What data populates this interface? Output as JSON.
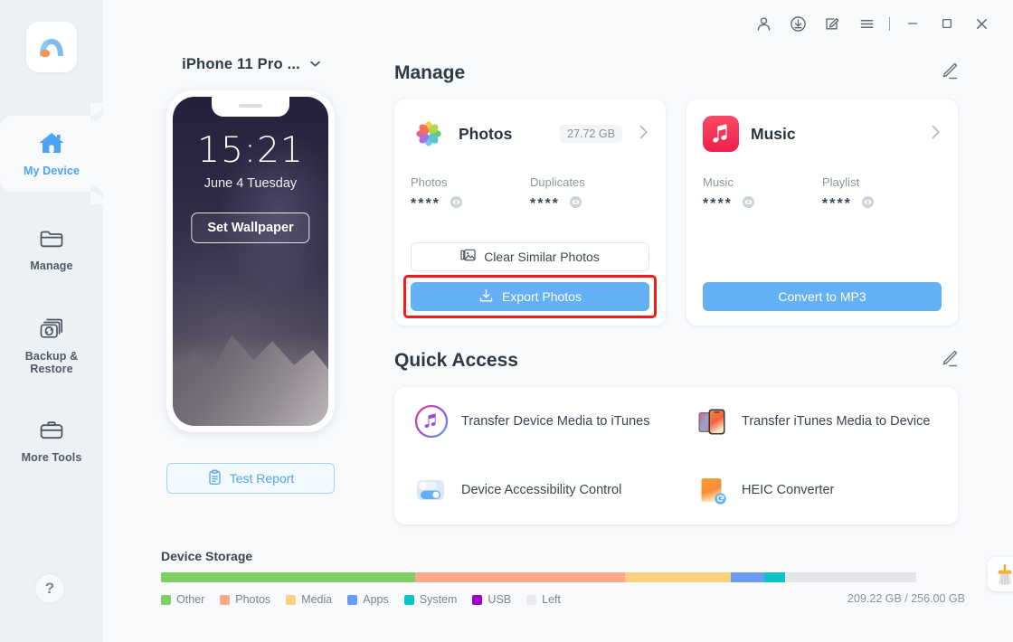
{
  "app": {
    "logo_name": "minitool-mobile-logo"
  },
  "titlebar": {
    "buttons": [
      {
        "name": "account-icon",
        "label": ""
      },
      {
        "name": "download-icon",
        "label": ""
      },
      {
        "name": "feedback-icon",
        "label": ""
      },
      {
        "name": "menu-icon",
        "label": ""
      }
    ],
    "window": [
      {
        "name": "minimize-button",
        "label": ""
      },
      {
        "name": "maximize-button",
        "label": ""
      },
      {
        "name": "close-button",
        "label": ""
      }
    ]
  },
  "sidebar": {
    "items": [
      {
        "label": "My Device",
        "icon": "home-icon",
        "active": true
      },
      {
        "label": "Manage",
        "icon": "folder-icon",
        "active": false
      },
      {
        "label": "Backup &\nRestore",
        "line1": "Backup &",
        "line2": "Restore",
        "icon": "backup-restore-icon",
        "active": false
      },
      {
        "label": "More Tools",
        "icon": "briefcase-icon",
        "active": false
      }
    ],
    "help_label": "?"
  },
  "device": {
    "name": "iPhone 11 Pro ...",
    "dropdown_icon": "chevron-down-icon",
    "lockscreen": {
      "time": "15:21",
      "date": "June 4 Tuesday",
      "wallpaper_button": "Set Wallpaper"
    },
    "tools": [
      {
        "name": "power-icon",
        "color": "#ef3b3b"
      },
      {
        "name": "brightness-icon",
        "color": "#9aa3ad"
      },
      {
        "name": "refresh-icon",
        "color": "#5a636e"
      }
    ],
    "test_report_label": "Test Report"
  },
  "manage": {
    "title": "Manage",
    "edit_icon": "pencil-icon",
    "cards": [
      {
        "name": "photos",
        "icon": "photos-app-icon",
        "title": "Photos",
        "size": "27.72 GB",
        "stats": [
          {
            "label": "Photos",
            "value": "****"
          },
          {
            "label": "Duplicates",
            "value": "****"
          }
        ],
        "secondary_button": {
          "label": "Clear Similar Photos",
          "icon": "similar-photos-icon"
        },
        "primary_button": {
          "label": "Export Photos",
          "icon": "export-icon"
        },
        "highlighted": true
      },
      {
        "name": "music",
        "icon": "music-app-icon",
        "title": "Music",
        "size": "",
        "stats": [
          {
            "label": "Music",
            "value": "****"
          },
          {
            "label": "Playlist",
            "value": "****"
          }
        ],
        "secondary_button": null,
        "primary_button": {
          "label": "Convert to MP3",
          "icon": ""
        },
        "highlighted": false
      }
    ]
  },
  "quick_access": {
    "title": "Quick Access",
    "edit_icon": "pencil-icon",
    "items": [
      {
        "label": "Transfer Device Media to iTunes",
        "icon": "itunes-icon"
      },
      {
        "label": "Transfer iTunes Media to Device",
        "icon": "devices-transfer-icon"
      },
      {
        "label": "Device Accessibility Control",
        "icon": "toggle-icon"
      },
      {
        "label": "HEIC Converter",
        "icon": "heic-converter-icon"
      }
    ]
  },
  "storage": {
    "title": "Device Storage",
    "total_text": "209.22 GB / 256.00 GB",
    "clean_icon": "broom-icon",
    "segments": [
      {
        "label": "Other",
        "color": "#7ed063",
        "percent": 33.6
      },
      {
        "label": "Photos",
        "color": "#ffa98a",
        "percent": 27.8
      },
      {
        "label": "Media",
        "color": "#fbd080",
        "percent": 14.1
      },
      {
        "label": "Apps",
        "color": "#6b9bf5",
        "percent": 4.4
      },
      {
        "label": "System",
        "color": "#0cc2c2",
        "percent": 2.7
      },
      {
        "label": "USB",
        "color": "#a006c6",
        "percent": 0
      },
      {
        "label": "Left",
        "color": "#e4e6e9",
        "percent": 17.4
      }
    ],
    "legend": [
      {
        "label": "Other",
        "color": "#7ed063"
      },
      {
        "label": "Photos",
        "color": "#ffa98a"
      },
      {
        "label": "Media",
        "color": "#fbd080"
      },
      {
        "label": "Apps",
        "color": "#6b9bf5"
      },
      {
        "label": "System",
        "color": "#0cc2c2"
      },
      {
        "label": "USB",
        "color": "#a006c6"
      },
      {
        "label": "Left",
        "color": "#e9ebee"
      }
    ]
  },
  "colors": {
    "accent": "#64b0f5",
    "active_nav": "#4ba3f2",
    "highlight": "#f01c1c",
    "sidebar_bg": "#eef1f4",
    "page_bg": "#f7f9fb"
  }
}
